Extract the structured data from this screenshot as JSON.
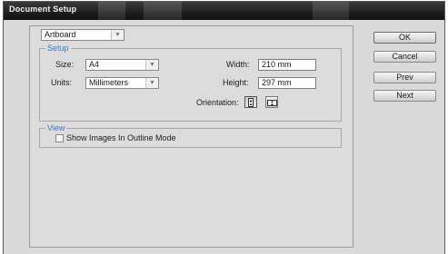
{
  "window": {
    "title": "Document Setup"
  },
  "artboard_select": {
    "value": "Artboard"
  },
  "setup": {
    "legend": "Setup",
    "size_label": "Size:",
    "size_value": "A4",
    "units_label": "Units:",
    "units_value": "Millimeters",
    "width_label": "Width:",
    "width_value": "210 mm",
    "height_label": "Height:",
    "height_value": "297 mm",
    "orientation_label": "Orientation:"
  },
  "view": {
    "legend": "View",
    "show_images_label": "Show Images In Outline Mode",
    "show_images_checked": false
  },
  "buttons": {
    "ok": "OK",
    "cancel": "Cancel",
    "prev": "Prev",
    "next": "Next"
  },
  "icons": {
    "select_arrow": "chevron-down-icon",
    "portrait": "portrait-orientation-icon",
    "landscape": "landscape-orientation-icon"
  }
}
